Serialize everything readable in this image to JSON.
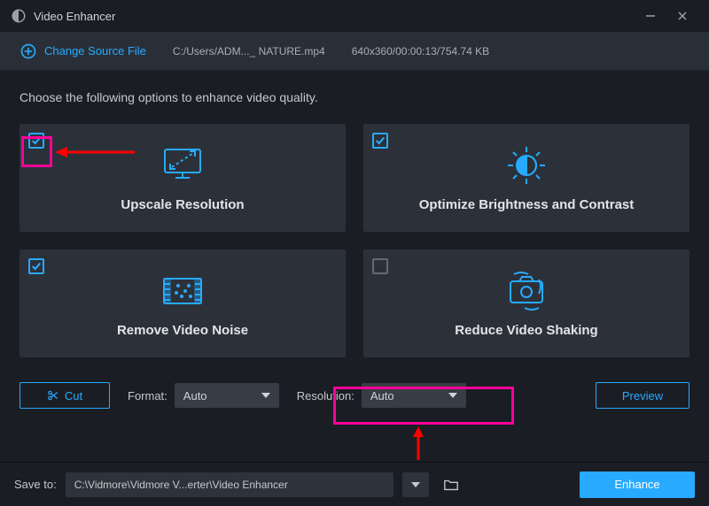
{
  "titlebar": {
    "title": "Video Enhancer"
  },
  "toolbar": {
    "change_source_label": "Change Source File",
    "source_path": "C:/Users/ADM..._ NATURE.mp4",
    "source_meta": "640x360/00:00:13/754.74 KB"
  },
  "instruction": "Choose the following options to enhance video quality.",
  "cards": {
    "upscale": {
      "label": "Upscale Resolution",
      "checked": true
    },
    "bright": {
      "label": "Optimize Brightness and Contrast",
      "checked": true
    },
    "denoise": {
      "label": "Remove Video Noise",
      "checked": true
    },
    "deshake": {
      "label": "Reduce Video Shaking",
      "checked": false
    }
  },
  "controls": {
    "cut_label": "Cut",
    "format_label": "Format:",
    "format_value": "Auto",
    "resolution_label": "Resolution:",
    "resolution_value": "Auto",
    "preview_label": "Preview"
  },
  "footer": {
    "save_label": "Save to:",
    "save_path": "C:\\Vidmore\\Vidmore V...erter\\Video Enhancer",
    "enhance_label": "Enhance"
  }
}
